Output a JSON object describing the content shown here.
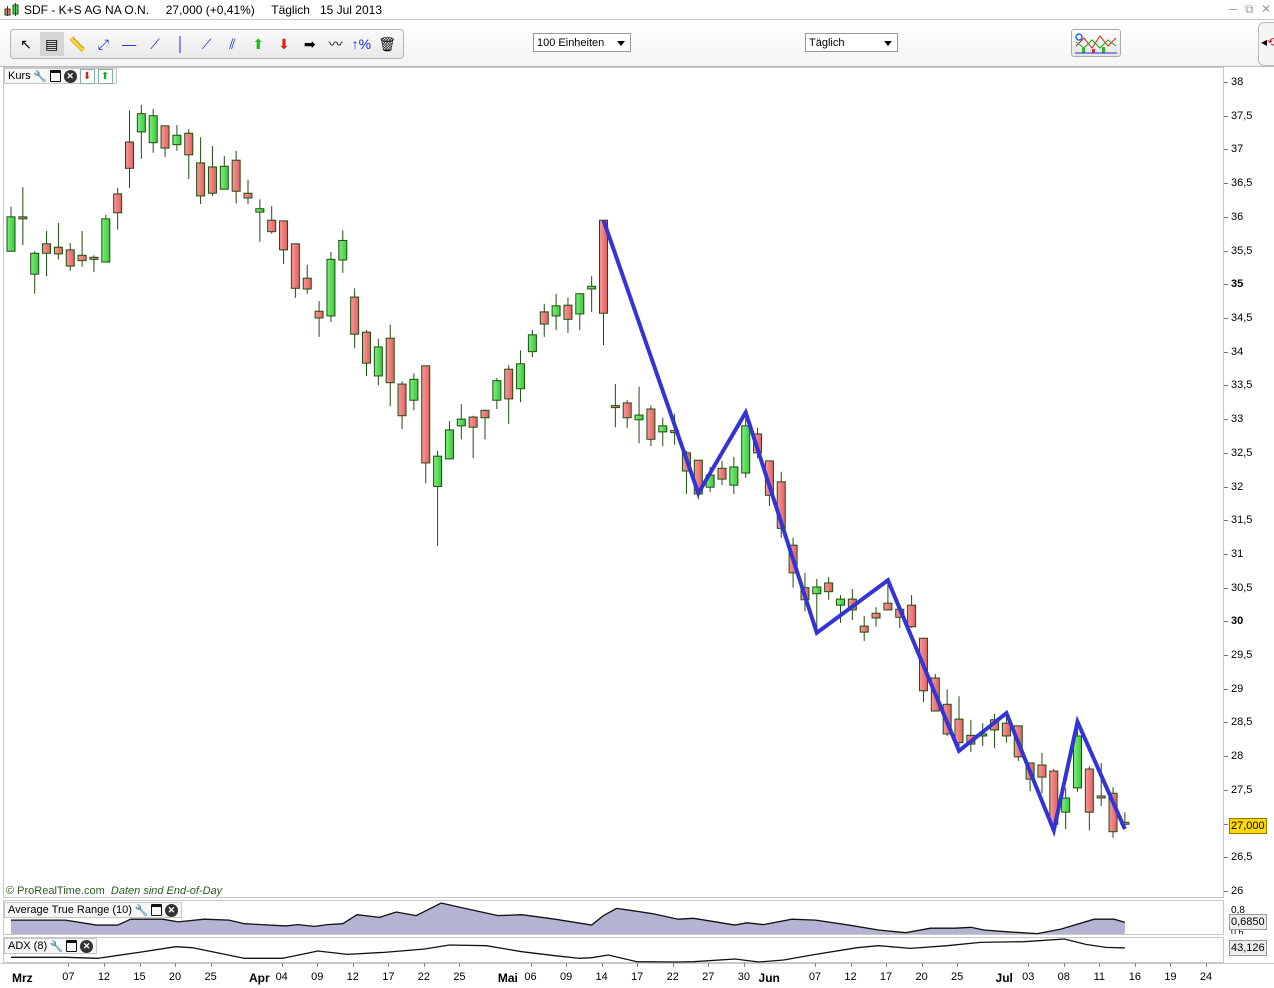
{
  "window": {
    "title_symbol": "SDF - K+S AG NA O.N.",
    "title_price": "27,000 (+0,41%)",
    "title_period": "Täglich",
    "title_date": "15 Jul 2013",
    "controls": [
      "minimize-icon",
      "restore-icon",
      "close-icon"
    ]
  },
  "toolbar": {
    "tools": [
      {
        "name": "pointer-tool",
        "glyph": "↖"
      },
      {
        "name": "chart-drawing-tool",
        "glyph": "▤"
      },
      {
        "name": "ruler-tool",
        "glyph": "📏"
      },
      {
        "name": "line-segment-tool",
        "glyph": "⤢"
      },
      {
        "name": "horizontal-line-tool",
        "glyph": "—"
      },
      {
        "name": "half-line-tool",
        "glyph": "⟋"
      },
      {
        "name": "vertical-line-tool",
        "glyph": "│"
      },
      {
        "name": "trend-line-tool",
        "glyph": "⟋"
      },
      {
        "name": "parallel-channel-tool",
        "glyph": "⫽"
      },
      {
        "name": "buy-arrow-tool",
        "glyph": "⬆"
      },
      {
        "name": "sell-arrow-tool",
        "glyph": "⬇"
      },
      {
        "name": "right-arrow-tool",
        "glyph": "➡"
      },
      {
        "name": "regression-tool",
        "glyph": "〰"
      },
      {
        "name": "percent-tool",
        "glyph": "↑%"
      },
      {
        "name": "trash-tool",
        "glyph": "🗑"
      }
    ],
    "units_select": "100 Einheiten",
    "period_select": "Täglich"
  },
  "price_panel": {
    "label": "Kurs",
    "copyright": "© ProRealTime.com",
    "eod_note": "Daten sind End-of-Day",
    "last_price_tag": "27,000"
  },
  "atr_panel": {
    "label": "Average True Range (10)",
    "value": "0,6850",
    "axis_labels": [
      "0,8",
      "0,6"
    ]
  },
  "adx_panel": {
    "label": "ADX (8)",
    "value": "43,126"
  },
  "colors": {
    "up": "#52d852",
    "down": "#ef7575",
    "outline": "#1e4d10",
    "zigzag": "#3434d6",
    "atr_fill": "#b4b4d2",
    "price_tag": "#ffd800"
  },
  "chart_data": {
    "type": "candlestick",
    "title": "SDF - K+S AG NA O.N.",
    "ylim": [
      26,
      38
    ],
    "ytick_labels": [
      "38",
      "37,5",
      "37",
      "36,5",
      "36",
      "35,5",
      "35",
      "34,5",
      "34",
      "33,5",
      "33",
      "32,5",
      "32",
      "31,5",
      "31",
      "30,5",
      "30",
      "29,5",
      "29",
      "28,5",
      "28",
      "27,5",
      "27",
      "26,5",
      "26"
    ],
    "ytick_bold": [
      "35",
      "30"
    ],
    "x_month_labels": [
      [
        "Mrz",
        0
      ],
      [
        "Apr",
        20
      ],
      [
        "Mai",
        41
      ],
      [
        "Jun",
        63
      ],
      [
        "Jul",
        83
      ]
    ],
    "x_day_labels": [
      [
        "07",
        4
      ],
      [
        "12",
        7
      ],
      [
        "15",
        10
      ],
      [
        "20",
        13
      ],
      [
        "25",
        16
      ],
      [
        "04",
        22
      ],
      [
        "09",
        25
      ],
      [
        "12",
        28
      ],
      [
        "17",
        31
      ],
      [
        "22",
        34
      ],
      [
        "25",
        37
      ],
      [
        "06",
        43
      ],
      [
        "09",
        46
      ],
      [
        "14",
        49
      ],
      [
        "17",
        52
      ],
      [
        "22",
        55
      ],
      [
        "27",
        58
      ],
      [
        "30",
        61
      ],
      [
        "07",
        67
      ],
      [
        "12",
        70
      ],
      [
        "17",
        73
      ],
      [
        "20",
        76
      ],
      [
        "25",
        79
      ],
      [
        "03",
        85
      ],
      [
        "08",
        88
      ],
      [
        "11",
        91
      ],
      [
        "16",
        94
      ],
      [
        "19",
        97
      ],
      [
        "24",
        100
      ]
    ],
    "ohlc_fields": [
      "open",
      "high",
      "low",
      "close"
    ],
    "candles": [
      [
        35.49,
        36.15,
        35.49,
        36.0
      ],
      [
        36.0,
        36.44,
        35.58,
        35.97
      ],
      [
        35.15,
        35.49,
        34.86,
        35.46
      ],
      [
        35.6,
        35.79,
        35.12,
        35.46
      ],
      [
        35.55,
        35.91,
        35.37,
        35.45
      ],
      [
        35.51,
        35.61,
        35.2,
        35.27
      ],
      [
        35.43,
        35.79,
        35.26,
        35.35
      ],
      [
        35.4,
        35.43,
        35.18,
        35.37
      ],
      [
        35.33,
        36.03,
        35.33,
        35.97
      ],
      [
        36.34,
        36.43,
        35.81,
        36.06
      ],
      [
        37.11,
        37.58,
        36.43,
        36.72
      ],
      [
        37.26,
        37.66,
        36.86,
        37.53
      ],
      [
        37.1,
        37.6,
        36.95,
        37.5
      ],
      [
        37.35,
        37.35,
        36.89,
        37.02
      ],
      [
        37.07,
        37.36,
        36.98,
        37.21
      ],
      [
        37.24,
        37.3,
        36.56,
        36.92
      ],
      [
        36.8,
        37.18,
        36.19,
        36.31
      ],
      [
        36.74,
        37.05,
        36.31,
        36.35
      ],
      [
        36.41,
        36.9,
        36.41,
        36.75
      ],
      [
        36.84,
        36.98,
        36.2,
        36.38
      ],
      [
        36.35,
        36.55,
        36.19,
        36.28
      ],
      [
        36.07,
        36.26,
        35.63,
        36.12
      ],
      [
        35.95,
        36.16,
        35.75,
        35.78
      ],
      [
        35.94,
        35.94,
        35.3,
        35.51
      ],
      [
        35.6,
        35.6,
        34.8,
        34.94
      ],
      [
        35.09,
        35.29,
        34.86,
        34.93
      ],
      [
        34.6,
        34.75,
        34.22,
        34.5
      ],
      [
        34.53,
        35.48,
        34.44,
        35.37
      ],
      [
        35.36,
        35.8,
        35.17,
        35.65
      ],
      [
        34.81,
        34.94,
        34.05,
        34.26
      ],
      [
        34.29,
        34.32,
        33.64,
        33.83
      ],
      [
        33.64,
        34.19,
        33.5,
        34.07
      ],
      [
        34.2,
        34.4,
        33.19,
        33.54
      ],
      [
        33.52,
        33.56,
        32.85,
        33.05
      ],
      [
        33.28,
        33.68,
        33.13,
        33.59
      ],
      [
        33.79,
        33.79,
        32.05,
        32.35
      ],
      [
        32.0,
        32.53,
        31.12,
        32.45
      ],
      [
        32.41,
        32.97,
        32.4,
        32.84
      ],
      [
        32.9,
        33.22,
        32.7,
        33.0
      ],
      [
        33.03,
        33.05,
        32.42,
        32.88
      ],
      [
        33.13,
        33.14,
        32.7,
        33.02
      ],
      [
        33.28,
        33.61,
        33.15,
        33.57
      ],
      [
        33.74,
        33.8,
        32.93,
        33.3
      ],
      [
        33.45,
        34.02,
        33.25,
        33.82
      ],
      [
        34.0,
        34.32,
        33.92,
        34.25
      ],
      [
        34.59,
        34.71,
        34.22,
        34.41
      ],
      [
        34.53,
        34.86,
        34.32,
        34.68
      ],
      [
        34.69,
        34.8,
        34.28,
        34.48
      ],
      [
        34.56,
        34.86,
        34.32,
        34.86
      ],
      [
        34.93,
        35.12,
        34.59,
        34.97
      ],
      [
        35.95,
        35.95,
        34.1,
        34.57
      ],
      [
        33.2,
        33.52,
        32.88,
        33.17
      ],
      [
        33.24,
        33.28,
        32.87,
        33.02
      ],
      [
        32.99,
        33.48,
        32.64,
        33.06
      ],
      [
        33.15,
        33.2,
        32.6,
        32.7
      ],
      [
        32.81,
        33.02,
        32.6,
        32.9
      ],
      [
        32.83,
        33.08,
        32.62,
        32.82
      ],
      [
        32.5,
        32.53,
        31.89,
        32.23
      ],
      [
        32.39,
        32.39,
        31.81,
        31.89
      ],
      [
        31.99,
        32.29,
        31.92,
        32.17
      ],
      [
        32.27,
        32.38,
        32.02,
        32.11
      ],
      [
        32.02,
        32.44,
        31.89,
        32.29
      ],
      [
        32.2,
        33.09,
        32.13,
        32.9
      ],
      [
        32.78,
        32.87,
        32.42,
        32.5
      ],
      [
        32.38,
        32.38,
        31.71,
        31.87
      ],
      [
        32.07,
        32.22,
        31.24,
        31.38
      ],
      [
        31.13,
        31.24,
        30.5,
        30.72
      ],
      [
        30.5,
        30.72,
        30.15,
        30.32
      ],
      [
        30.41,
        30.63,
        29.83,
        30.51
      ],
      [
        30.57,
        30.66,
        30.32,
        30.44
      ],
      [
        30.24,
        30.39,
        29.98,
        30.33
      ],
      [
        30.33,
        30.48,
        30.02,
        30.17
      ],
      [
        29.93,
        30.08,
        29.71,
        29.84
      ],
      [
        30.12,
        30.21,
        29.92,
        30.05
      ],
      [
        30.27,
        30.57,
        30.17,
        30.17
      ],
      [
        30.18,
        30.18,
        29.9,
        30.06
      ],
      [
        30.24,
        30.39,
        29.9,
        29.92
      ],
      [
        29.75,
        29.75,
        28.8,
        28.97
      ],
      [
        29.16,
        29.22,
        28.67,
        28.67
      ],
      [
        28.77,
        28.99,
        28.3,
        28.33
      ],
      [
        28.55,
        28.89,
        28.1,
        28.2
      ],
      [
        28.31,
        28.54,
        28.06,
        28.18
      ],
      [
        28.3,
        28.49,
        28.15,
        28.33
      ],
      [
        28.54,
        28.63,
        28.12,
        28.39
      ],
      [
        28.49,
        28.64,
        28.2,
        28.3
      ],
      [
        28.45,
        28.45,
        27.93,
        27.99
      ],
      [
        27.9,
        27.9,
        27.48,
        27.66
      ],
      [
        27.87,
        28.05,
        27.45,
        27.69
      ],
      [
        27.78,
        27.81,
        26.98,
        26.99
      ],
      [
        27.17,
        27.53,
        26.92,
        27.38
      ],
      [
        27.53,
        28.46,
        27.47,
        28.3
      ],
      [
        27.81,
        27.85,
        26.9,
        27.17
      ],
      [
        27.41,
        27.9,
        27.26,
        27.4
      ],
      [
        27.45,
        27.54,
        26.79,
        26.88
      ],
      [
        27.02,
        27.17,
        26.97,
        27.0
      ]
    ],
    "zigzag": [
      [
        50,
        35.95
      ],
      [
        58,
        31.9
      ],
      [
        62,
        33.1
      ],
      [
        68,
        29.83
      ],
      [
        74,
        30.61
      ],
      [
        80,
        28.08
      ],
      [
        84,
        28.64
      ],
      [
        88,
        26.9
      ],
      [
        90,
        28.51
      ],
      [
        94,
        26.92
      ]
    ],
    "atr": {
      "ylim": [
        0.544,
        0.92
      ],
      "points": [
        [
          0,
          0.71
        ],
        [
          4.6,
          0.71
        ],
        [
          7.2,
          0.655
        ],
        [
          9,
          0.655
        ],
        [
          10.1,
          0.72
        ],
        [
          12.8,
          0.72
        ],
        [
          14.1,
          0.69
        ],
        [
          16.3,
          0.72
        ],
        [
          18.4,
          0.71
        ],
        [
          19.7,
          0.67
        ],
        [
          23.2,
          0.645
        ],
        [
          24.2,
          0.66
        ],
        [
          25.6,
          0.64
        ],
        [
          26.7,
          0.66
        ],
        [
          28,
          0.67
        ],
        [
          29.2,
          0.77
        ],
        [
          31.1,
          0.74
        ],
        [
          32.5,
          0.8
        ],
        [
          34.2,
          0.76
        ],
        [
          36.3,
          0.9
        ],
        [
          38.3,
          0.84
        ],
        [
          41.1,
          0.76
        ],
        [
          43.1,
          0.77
        ],
        [
          45.9,
          0.72
        ],
        [
          49,
          0.655
        ],
        [
          50,
          0.76
        ],
        [
          51.1,
          0.84
        ],
        [
          52.2,
          0.82
        ],
        [
          54.2,
          0.78
        ],
        [
          56.3,
          0.72
        ],
        [
          57.6,
          0.73
        ],
        [
          61.1,
          0.655
        ],
        [
          62.1,
          0.68
        ],
        [
          63.5,
          0.66
        ],
        [
          65.9,
          0.72
        ],
        [
          67.9,
          0.71
        ],
        [
          70.7,
          0.655
        ],
        [
          73.2,
          0.6
        ],
        [
          75.5,
          0.57
        ],
        [
          77.6,
          0.62
        ],
        [
          79.7,
          0.62
        ],
        [
          81,
          0.63
        ],
        [
          82.1,
          0.6
        ],
        [
          84.1,
          0.58
        ],
        [
          86.6,
          0.56
        ],
        [
          88.6,
          0.61
        ],
        [
          91.4,
          0.72
        ],
        [
          93.1,
          0.72
        ],
        [
          94,
          0.685
        ]
      ]
    },
    "adx": {
      "ylim": [
        25,
        55
      ],
      "points": [
        [
          0,
          31.8
        ],
        [
          4.6,
          31.8
        ],
        [
          7.3,
          30.6
        ],
        [
          10.8,
          37.8
        ],
        [
          13.9,
          44.6
        ],
        [
          15.3,
          43.4
        ],
        [
          19.7,
          30.6
        ],
        [
          22.9,
          30.6
        ],
        [
          25.9,
          39.4
        ],
        [
          28.4,
          35.4
        ],
        [
          31.5,
          37.8
        ],
        [
          34.9,
          41.8
        ],
        [
          37,
          46.6
        ],
        [
          40.1,
          45.8
        ],
        [
          43.1,
          38.6
        ],
        [
          45.9,
          33.8
        ],
        [
          48,
          30.6
        ],
        [
          49,
          31.4
        ],
        [
          50.4,
          34.6
        ],
        [
          52.8,
          26.6
        ],
        [
          56.3,
          25
        ],
        [
          57.6,
          26.6
        ],
        [
          61.1,
          29.8
        ],
        [
          63.1,
          25.8
        ],
        [
          65.2,
          28.6
        ],
        [
          67.9,
          35.4
        ],
        [
          71.4,
          43.4
        ],
        [
          73.2,
          45.8
        ],
        [
          75.9,
          42.6
        ],
        [
          79,
          45.8
        ],
        [
          81.8,
          49.8
        ],
        [
          85.5,
          50.6
        ],
        [
          88.9,
          53.8
        ],
        [
          90.7,
          47.4
        ],
        [
          92.4,
          43.8
        ],
        [
          94,
          43.1
        ]
      ]
    }
  }
}
